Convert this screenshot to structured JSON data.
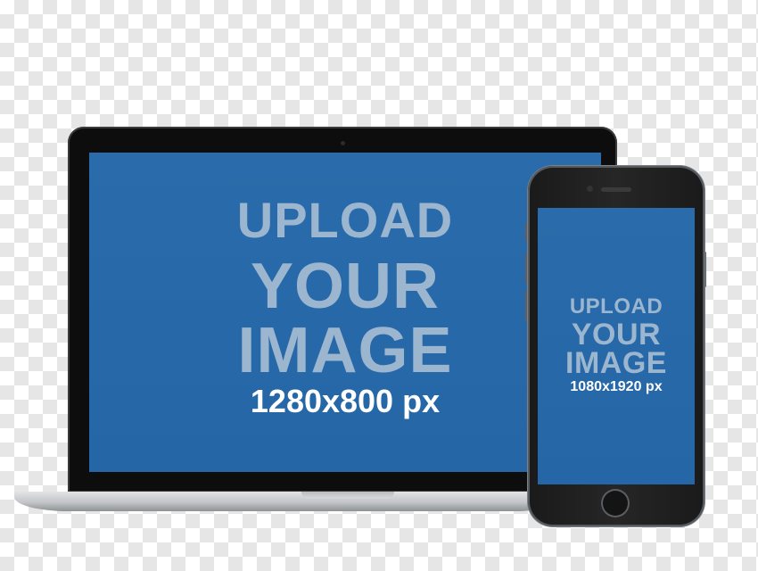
{
  "laptop": {
    "line1": "UPLOAD",
    "line2": "YOUR",
    "line3": "IMAGE",
    "size": "1280x800 px"
  },
  "phone": {
    "line1": "UPLOAD",
    "line2": "YOUR",
    "line3": "IMAGE",
    "size": "1080x1920 px"
  },
  "colors": {
    "screen_blue": "#2668a8",
    "placeholder_text": "#9cb6cf",
    "device_black": "#0d0d0d"
  }
}
